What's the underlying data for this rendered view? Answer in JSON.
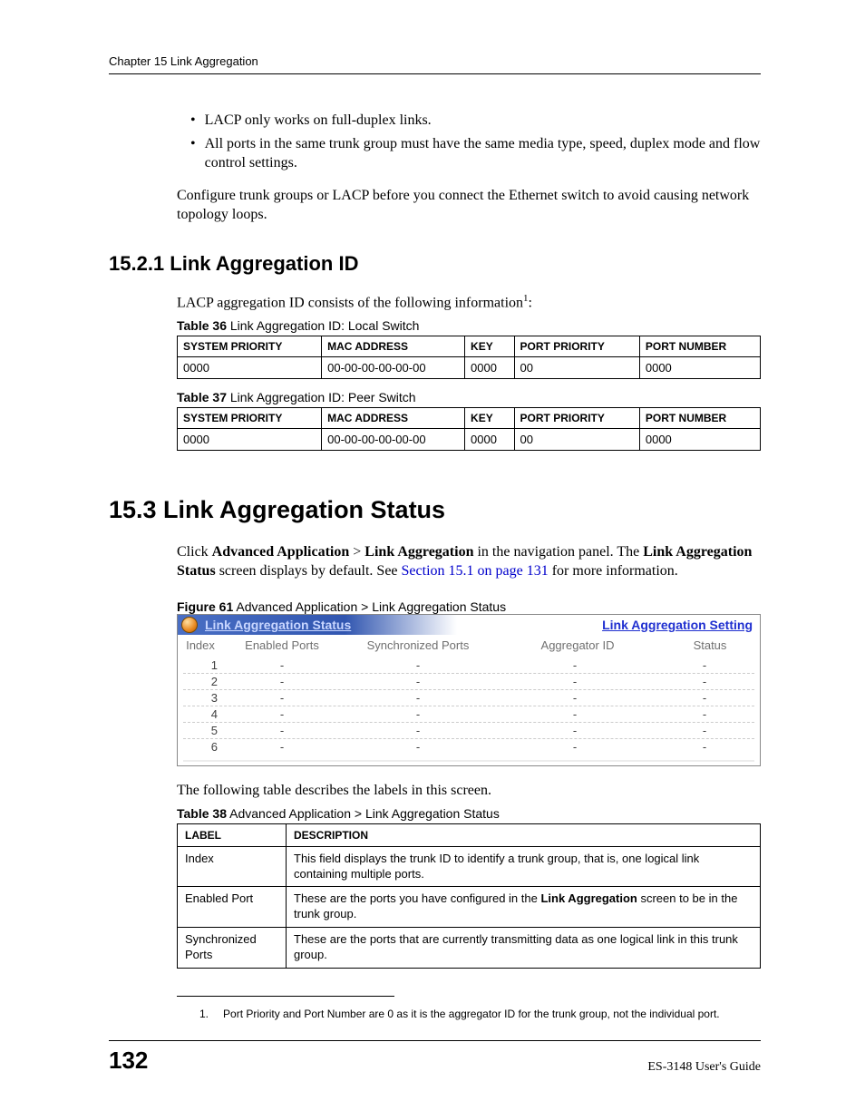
{
  "header": {
    "chapter": "Chapter 15 Link Aggregation"
  },
  "bullets": [
    "LACP only works on full-duplex links.",
    "All ports in the same trunk group must have the same media type, speed, duplex mode and flow control settings."
  ],
  "para_configure": "Configure trunk groups or LACP before you connect the Ethernet switch to avoid causing network topology loops.",
  "section_15_2_1": {
    "heading": "15.2.1  Link Aggregation ID",
    "intro_pre": "LACP aggregation ID consists of the following information",
    "intro_sup": "1",
    "intro_post": ":"
  },
  "table36": {
    "caption_bold": "Table 36",
    "caption_rest": "   Link Aggregation ID: Local Switch",
    "headers": [
      "SYSTEM PRIORITY",
      "MAC ADDRESS",
      "KEY",
      "PORT PRIORITY",
      "PORT NUMBER"
    ],
    "row": [
      "0000",
      "00-00-00-00-00-00",
      "0000",
      "00",
      "0000"
    ]
  },
  "table37": {
    "caption_bold": "Table 37",
    "caption_rest": "   Link Aggregation ID: Peer Switch",
    "headers": [
      "SYSTEM PRIORITY",
      "MAC ADDRESS",
      "KEY",
      "PORT PRIORITY",
      "PORT NUMBER"
    ],
    "row": [
      "0000",
      "00-00-00-00-00-00",
      "0000",
      "00",
      "0000"
    ]
  },
  "section_15_3": {
    "heading": "15.3  Link Aggregation Status",
    "p1_a": "Click ",
    "p1_b": "Advanced Application",
    "p1_c": " > ",
    "p1_d": "Link Aggregation",
    "p1_e": " in the navigation panel. The ",
    "p1_f": "Link Aggregation Status",
    "p1_g": " screen displays by default. See ",
    "p1_link": "Section 15.1 on page 131",
    "p1_h": " for more information."
  },
  "figure61": {
    "caption_bold": "Figure 61",
    "caption_rest": "   Advanced Application > Link Aggregation Status",
    "title": "Link Aggregation Status",
    "link": "Link Aggregation Setting",
    "cols": {
      "index": "Index",
      "enabled": "Enabled Ports",
      "sync": "Synchronized Ports",
      "agg": "Aggregator ID",
      "status": "Status"
    },
    "rows": [
      {
        "index": "1",
        "enabled": "-",
        "sync": "-",
        "agg": "-",
        "status": "-"
      },
      {
        "index": "2",
        "enabled": "-",
        "sync": "-",
        "agg": "-",
        "status": "-"
      },
      {
        "index": "3",
        "enabled": "-",
        "sync": "-",
        "agg": "-",
        "status": "-"
      },
      {
        "index": "4",
        "enabled": "-",
        "sync": "-",
        "agg": "-",
        "status": "-"
      },
      {
        "index": "5",
        "enabled": "-",
        "sync": "-",
        "agg": "-",
        "status": "-"
      },
      {
        "index": "6",
        "enabled": "-",
        "sync": "-",
        "agg": "-",
        "status": "-"
      }
    ]
  },
  "para_following": "The following table describes the labels in this screen.",
  "table38": {
    "caption_bold": "Table 38",
    "caption_rest": "   Advanced Application > Link Aggregation Status",
    "headers": [
      "LABEL",
      "DESCRIPTION"
    ],
    "rows": [
      {
        "label": "Index",
        "desc": "This field displays the trunk ID to identify a trunk group, that is, one logical link containing multiple ports."
      },
      {
        "label": "Enabled Port",
        "desc_a": "These are the ports you have configured in the ",
        "desc_b": "Link Aggregation",
        "desc_c": " screen to be in the trunk group."
      },
      {
        "label": "Synchronized Ports",
        "desc": "These are the ports that are currently transmitting data as one logical link in this trunk group."
      }
    ]
  },
  "footnote": {
    "num": "1.",
    "text": "Port Priority and Port Number are 0 as it is the aggregator ID for the trunk group, not the individual port."
  },
  "footer": {
    "page": "132",
    "guide": "ES-3148 User's Guide"
  }
}
